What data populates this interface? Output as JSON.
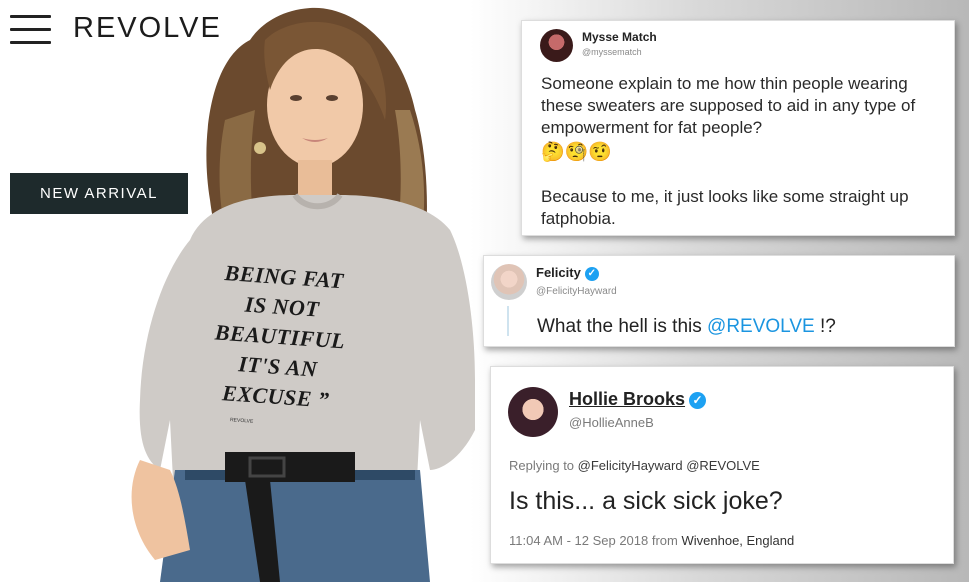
{
  "header": {
    "brand": "REVOLVE",
    "badge": "NEW ARRIVAL"
  },
  "sweater": {
    "lines": [
      "BEING FAT",
      "IS NOT",
      "BEAUTIFUL",
      "IT'S AN",
      "EXCUSE ”"
    ],
    "fine_print": "REVOLVE"
  },
  "tweets": [
    {
      "name": "Mysse Match",
      "handle": "@myssematch",
      "text": "Someone explain to me how thin people wearing these sweaters are supposed to aid in any type of empowerment for fat people?",
      "emoji": "🤔🧐🤨",
      "text2": "Because to me, it just looks like some straight up fatphobia."
    },
    {
      "name": "Felicity",
      "handle": "@FelicityHayward",
      "text": "What the hell is this ",
      "mention": "@REVOLVE",
      "text_end": " !?"
    },
    {
      "name": "Hollie Brooks",
      "handle": "@HollieAnneB",
      "reply_prefix": "Replying to ",
      "reply_to": "@FelicityHayward @REVOLVE",
      "text": "Is this... a sick sick joke?",
      "meta_time": "11:04 AM - 12 Sep 2018 from ",
      "meta_location": "Wivenhoe, England"
    }
  ],
  "colors": {
    "badge_bg": "#1e2a2c",
    "link_blue": "#1b95e0",
    "verified_blue": "#1da1f2"
  }
}
